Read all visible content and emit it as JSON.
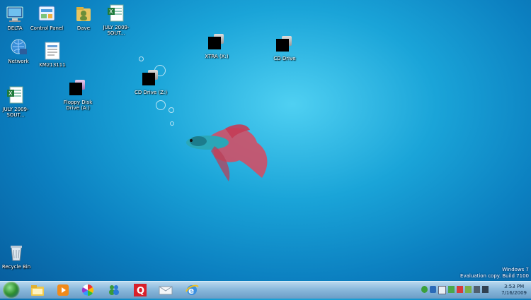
{
  "desktop": {
    "icons": [
      {
        "label": "DELTA",
        "icon": "computer-icon"
      },
      {
        "label": "Control Panel",
        "icon": "control-panel-icon"
      },
      {
        "label": "Dave",
        "icon": "user-folder-icon"
      },
      {
        "label": "JULY 2009-SOUT...",
        "icon": "excel-file-icon"
      },
      {
        "label": "Network",
        "icon": "network-icon"
      },
      {
        "label": "KM213111",
        "icon": "document-icon"
      },
      {
        "label": "XTRA (X:)",
        "icon": "drive-icon"
      },
      {
        "label": "CD Drive",
        "icon": "cd-drive-icon"
      },
      {
        "label": "CD Drive (Z:)",
        "icon": "cd-drive-icon"
      },
      {
        "label": "Floppy Disk Drive (A:)",
        "icon": "floppy-drive-icon"
      },
      {
        "label": "JULY 2009-SOUT...",
        "icon": "excel-file-icon"
      },
      {
        "label": "Recycle Bin",
        "icon": "recycle-bin-icon"
      }
    ]
  },
  "watermark": {
    "line1": "Windows 7",
    "line2": "Evaluation copy. Build 7100"
  },
  "taskbar": {
    "pinned": [
      "explorer-icon",
      "media-player-icon",
      "picasa-icon",
      "messenger-icon",
      "quicken-icon",
      "mail-icon",
      "internet-explorer-icon"
    ],
    "clock": {
      "time": "3:53 PM",
      "date": "7/16/2009"
    }
  },
  "colors": {
    "desktop": "#1aa4d8",
    "taskbar": "#8bb9dc"
  }
}
